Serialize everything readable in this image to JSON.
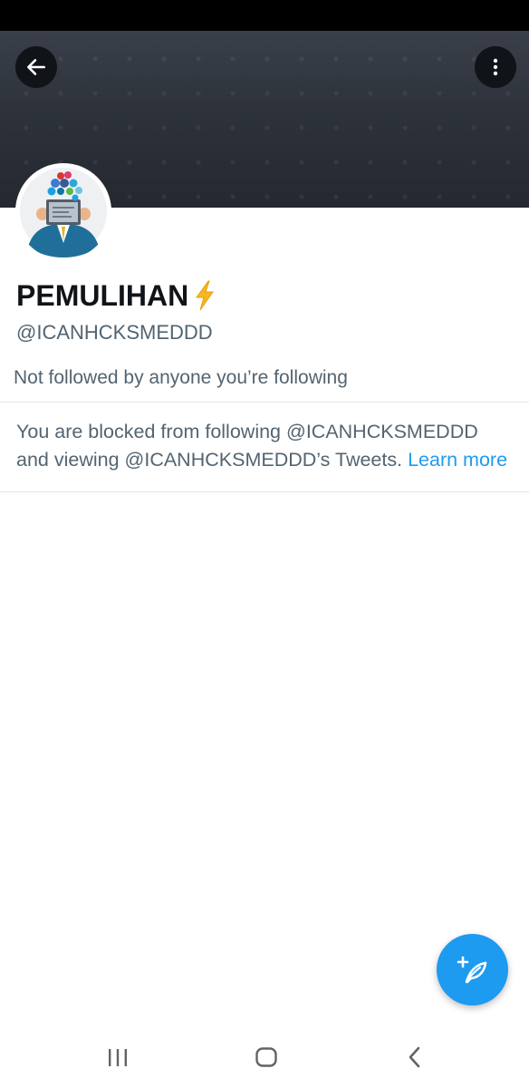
{
  "profile": {
    "display_name": "PEMULIHAN",
    "name_emoji_icon": "lightning-bolt-icon",
    "handle": "@ICANHCKSMEDDD",
    "followed_info": "Not followed by anyone you’re following"
  },
  "blocked_notice": {
    "line1": "You are blocked from following @ICANHCKSMEDDD",
    "line2_prefix": "and viewing @ICANHCKSMEDDD’s Tweets.",
    "learn_more": "Learn more"
  },
  "header": {
    "back_icon": "arrow-left-icon",
    "more_icon": "more-vertical-icon"
  },
  "fab": {
    "icon": "compose-tweet-icon"
  },
  "system_nav": {
    "recents_icon": "recent-apps-icon",
    "home_icon": "home-icon",
    "back_icon": "chevron-left-icon"
  },
  "colors": {
    "accent": "#1d9bf0",
    "text_primary": "#0f1419",
    "text_secondary": "#536471",
    "banner": "#2d323b"
  }
}
